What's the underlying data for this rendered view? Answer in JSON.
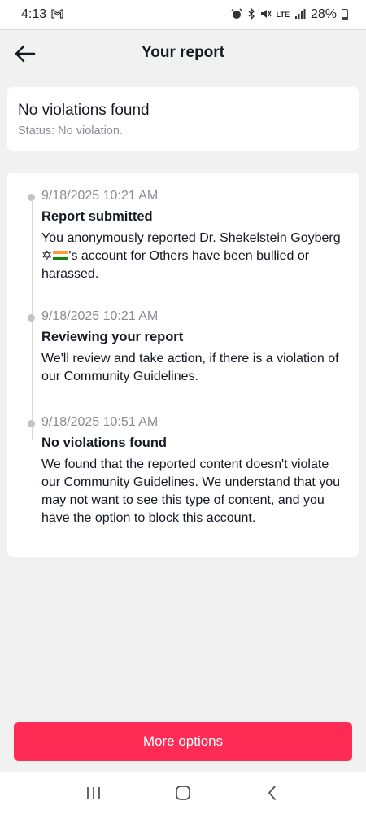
{
  "status_bar": {
    "time": "4:13",
    "network": "LTE",
    "battery": "28%"
  },
  "header": {
    "title": "Your report",
    "back_icon": "arrow-left-icon"
  },
  "summary": {
    "title": "No violations found",
    "status": "Status: No violation."
  },
  "timeline": [
    {
      "time": "9/18/2025 10:21 AM",
      "heading": "Report submitted",
      "body_before": "You anonymously reported Dr. Shekelstein Goyberg ",
      "body_symbol": "✡",
      "body_after": "'s account for Others have been bullied or harassed."
    },
    {
      "time": "9/18/2025 10:21 AM",
      "heading": "Reviewing your report",
      "body": "We'll review and take action, if there is a violation of our Community Guidelines."
    },
    {
      "time": "9/18/2025 10:51 AM",
      "heading": "No violations found",
      "body": "We found that the reported content doesn't violate our Community Guidelines. We understand that you may not want to see this type of content, and you have the option to block this account."
    }
  ],
  "actions": {
    "more_options": "More options"
  },
  "colors": {
    "accent": "#fe2c55",
    "background": "#f1f1f2",
    "card": "#ffffff",
    "muted_text": "#8a8b91"
  }
}
